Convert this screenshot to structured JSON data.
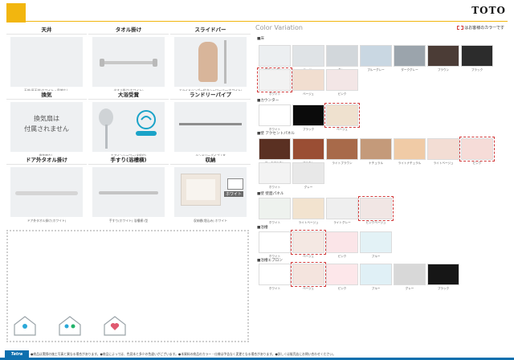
{
  "brand": {
    "logo": "TOTO"
  },
  "options": [
    {
      "title": "天井",
      "caption": "天井(平天井)ホワイト・目地なし"
    },
    {
      "title": "タオル掛け",
      "caption": "タオル掛け(ホワイト)"
    },
    {
      "title": "スライドバー",
      "caption": "スライドハンガー付きシャワーバー(ホワイト)"
    },
    {
      "title": "換気",
      "caption": "換気扇なし",
      "body1": "換気扇は",
      "body2": "付属されません"
    },
    {
      "title": "大浴受賞",
      "caption": "エアインシャワー(水栓付)"
    },
    {
      "title": "ランドリーパイプ",
      "caption": "ランドリーパイプ 1本"
    },
    {
      "title": "ドア外タオル掛け",
      "caption": "ドア外タオル掛け(ホワイト)"
    },
    {
      "title": "手すり(浴槽横)",
      "caption": "手すり(ホワイト) 浴槽横 I型"
    },
    {
      "title": "収納",
      "caption": "収納棚(埋込み) ホワイト",
      "swatch_label": "ホワイト"
    }
  ],
  "color_variation": {
    "title": "Color Variation",
    "note": "はお客様のカラーです",
    "sections": [
      {
        "label": "■床",
        "swatches": [
          {
            "name": "ホワイトグレー",
            "color": "#eceff1"
          },
          {
            "name": "ベージュ",
            "color": "#dfe3e6"
          },
          {
            "name": "グレー",
            "color": "#d2d7db"
          },
          {
            "name": "ブルーグレー",
            "color": "#c9d7e2"
          },
          {
            "name": "ダークグレー",
            "color": "#9ba4ac"
          },
          {
            "name": "ブラウン",
            "color": "#4b3c36"
          },
          {
            "name": "ブラック",
            "color": "#2c2c2c"
          },
          {
            "name": "ホワイト",
            "color": "#f2f2f2",
            "selected": true
          },
          {
            "name": "ベージュ",
            "color": "#f1ded0"
          },
          {
            "name": "ピンク",
            "color": "#f3e6e6"
          }
        ]
      },
      {
        "label": "■カウンター",
        "swatches": [
          {
            "name": "ホワイト",
            "color": "#ffffff"
          },
          {
            "name": "ブラック",
            "color": "#0b0b0b"
          },
          {
            "name": "ベージュ",
            "color": "#efe1cf",
            "selected": true
          }
        ]
      },
      {
        "label": "■壁 アクセントパネル",
        "swatches": [
          {
            "name": "ダークブラウン",
            "color": "#5a3022"
          },
          {
            "name": "ブラウン",
            "color": "#9a4e34"
          },
          {
            "name": "ライトブラウン",
            "color": "#a86a4a"
          },
          {
            "name": "ナチュラル",
            "color": "#c49a7a"
          },
          {
            "name": "ライトナチュラル",
            "color": "#f0cba6"
          },
          {
            "name": "ライトベージュ",
            "color": "#f3ddd4"
          },
          {
            "name": "ピンク",
            "color": "#f6dcd8",
            "selected": true
          },
          {
            "name": "ホワイト",
            "color": "#f3f3f3"
          },
          {
            "name": "グレー",
            "color": "#e8e8e8"
          }
        ]
      },
      {
        "label": "■壁 壁面パネル",
        "swatches": [
          {
            "name": "ホワイト",
            "color": "#eef2ee"
          },
          {
            "name": "ライトベージュ",
            "color": "#f2e3cf"
          },
          {
            "name": "ライトグレー",
            "color": "#efefef"
          },
          {
            "name": "ピンクベージュ",
            "color": "#f1e6e4",
            "selected": true
          }
        ]
      },
      {
        "label": "■浴槽",
        "swatches": [
          {
            "name": "ホワイト",
            "color": "#ffffff"
          },
          {
            "name": "ベージュ",
            "color": "#f4e8e3",
            "selected": true
          },
          {
            "name": "ピンク",
            "color": "#fbe5e8"
          },
          {
            "name": "ブルー",
            "color": "#e3f2f6"
          }
        ]
      },
      {
        "label": "■浴槽エプロン",
        "swatches": [
          {
            "name": "ホワイト",
            "color": "#ffffff"
          },
          {
            "name": "ベージュ",
            "color": "#f4e4de",
            "selected": true
          },
          {
            "name": "ピンク",
            "color": "#fde7ea"
          },
          {
            "name": "ブルー",
            "color": "#e0f0f6"
          },
          {
            "name": "グレー",
            "color": "#d8d8d8"
          },
          {
            "name": "ブラック",
            "color": "#161616"
          }
        ]
      }
    ]
  },
  "footer": {
    "tag": "Tetra",
    "text": "●商品は実際の施工写真と異なる場合があります。●商品によっては、色見本と多少の色違いがございます。●本資料の商品のカラー・仕様は予告なく変更となる場合があります。●詳しくは販売店にお問い合わせください。"
  }
}
